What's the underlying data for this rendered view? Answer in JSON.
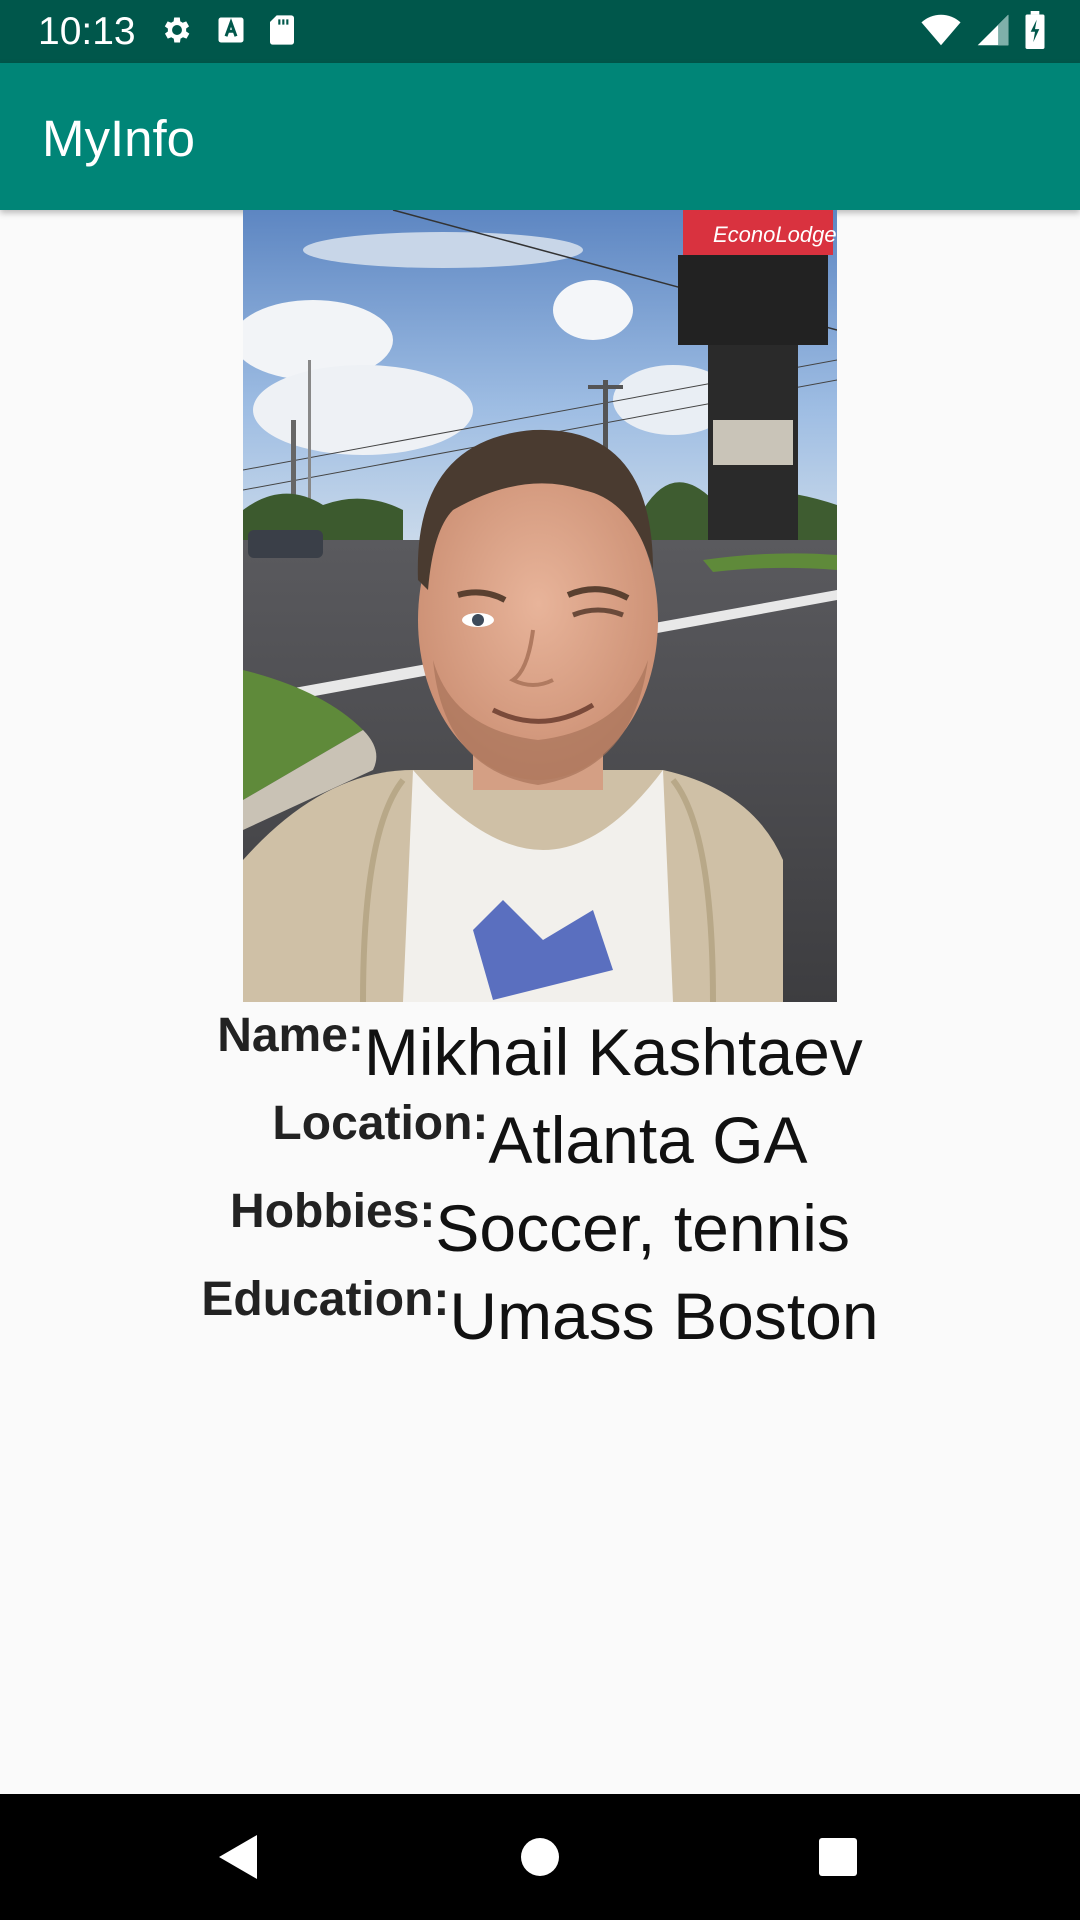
{
  "status_bar": {
    "time": "10:13",
    "icons_left": [
      "settings-icon",
      "a-notification-icon",
      "sd-card-icon"
    ],
    "icons_right": [
      "wifi-icon",
      "cell-signal-icon",
      "battery-charging-icon"
    ],
    "background": "#00574b"
  },
  "app_bar": {
    "title": "MyInfo",
    "background": "#008577"
  },
  "profile": {
    "photo": {
      "alt": "profile-photo",
      "sign_text": "EconoLodge"
    },
    "fields": [
      {
        "label": "Name:",
        "value": "Mikhail Kashtaev"
      },
      {
        "label": "Location:",
        "value": "Atlanta GA"
      },
      {
        "label": "Hobbies:",
        "value": "Soccer, tennis"
      },
      {
        "label": "Education:",
        "value": "Umass Boston"
      }
    ]
  },
  "nav_bar": {
    "buttons": [
      "back-icon",
      "home-icon",
      "recents-icon"
    ]
  }
}
